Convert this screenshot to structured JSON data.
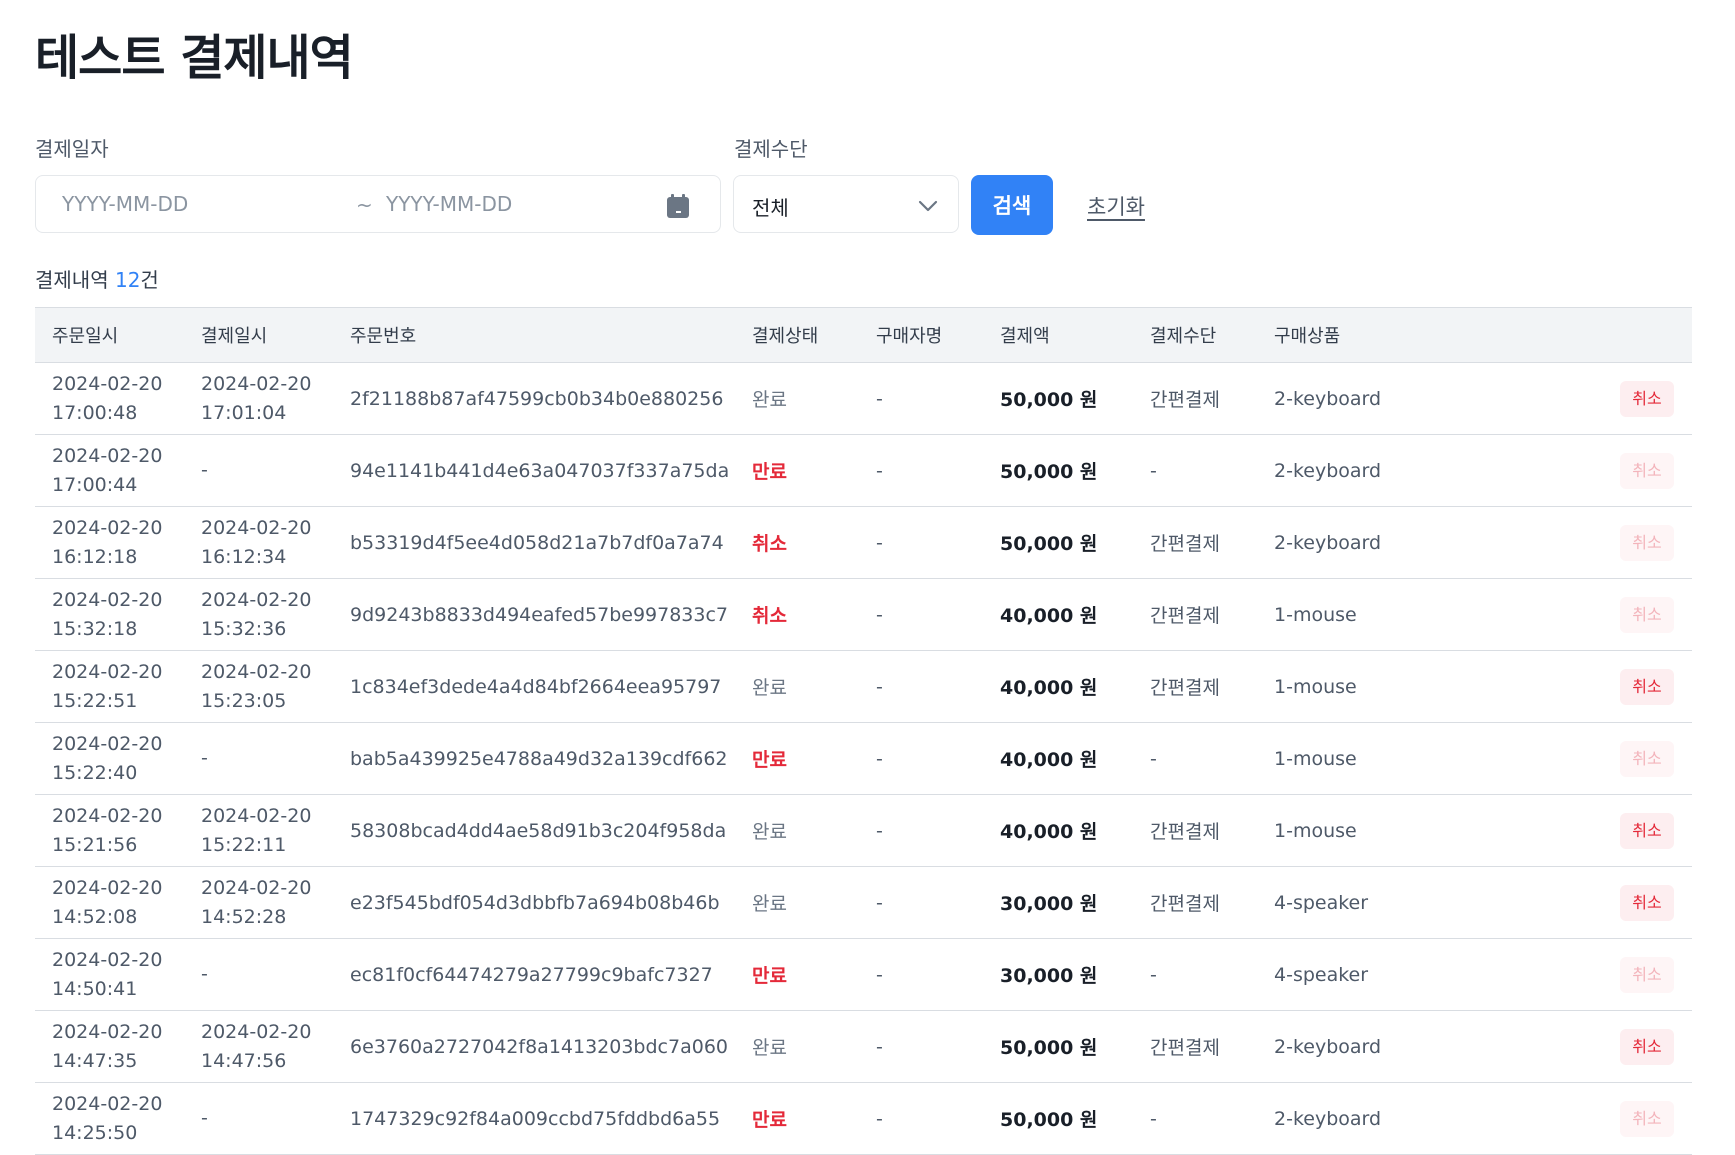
{
  "page": {
    "title": "테스트 결제내역"
  },
  "filters": {
    "date_label": "결제일자",
    "start_placeholder": "YYYY-MM-DD",
    "separator": "~",
    "end_placeholder": "YYYY-MM-DD",
    "method_label": "결제수단",
    "method_value": "전체",
    "search_label": "검색",
    "reset_label": "초기화"
  },
  "summary": {
    "prefix": "결제내역",
    "count": "12",
    "suffix": "건"
  },
  "colors": {
    "accent": "#3182f6",
    "danger": "#e42939",
    "header_bg": "#f2f4f6"
  },
  "table": {
    "headers": [
      "주문일시",
      "결제일시",
      "주문번호",
      "결제상태",
      "구매자명",
      "결제액",
      "결제수단",
      "구매상품"
    ],
    "cancel_label": "취소",
    "rows": [
      {
        "order_date": "2024-02-20",
        "order_time": "17:00:48",
        "pay_date": "2024-02-20",
        "pay_time": "17:01:04",
        "order_no": "2f21188b87af47599cb0b34b0e880256",
        "status": "완료",
        "buyer": "-",
        "amount": "50,000 원",
        "method": "간편결제",
        "product": "2-keyboard",
        "cancel_enabled": true
      },
      {
        "order_date": "2024-02-20",
        "order_time": "17:00:44",
        "pay_date": "-",
        "pay_time": "",
        "order_no": "94e1141b441d4e63a047037f337a75da",
        "status": "만료",
        "buyer": "-",
        "amount": "50,000 원",
        "method": "-",
        "product": "2-keyboard",
        "cancel_enabled": false
      },
      {
        "order_date": "2024-02-20",
        "order_time": "16:12:18",
        "pay_date": "2024-02-20",
        "pay_time": "16:12:34",
        "order_no": "b53319d4f5ee4d058d21a7b7df0a7a74",
        "status": "취소",
        "buyer": "-",
        "amount": "50,000 원",
        "method": "간편결제",
        "product": "2-keyboard",
        "cancel_enabled": false
      },
      {
        "order_date": "2024-02-20",
        "order_time": "15:32:18",
        "pay_date": "2024-02-20",
        "pay_time": "15:32:36",
        "order_no": "9d9243b8833d494eafed57be997833c7",
        "status": "취소",
        "buyer": "-",
        "amount": "40,000 원",
        "method": "간편결제",
        "product": "1-mouse",
        "cancel_enabled": false
      },
      {
        "order_date": "2024-02-20",
        "order_time": "15:22:51",
        "pay_date": "2024-02-20",
        "pay_time": "15:23:05",
        "order_no": "1c834ef3dede4a4d84bf2664eea95797",
        "status": "완료",
        "buyer": "-",
        "amount": "40,000 원",
        "method": "간편결제",
        "product": "1-mouse",
        "cancel_enabled": true
      },
      {
        "order_date": "2024-02-20",
        "order_time": "15:22:40",
        "pay_date": "-",
        "pay_time": "",
        "order_no": "bab5a439925e4788a49d32a139cdf662",
        "status": "만료",
        "buyer": "-",
        "amount": "40,000 원",
        "method": "-",
        "product": "1-mouse",
        "cancel_enabled": false
      },
      {
        "order_date": "2024-02-20",
        "order_time": "15:21:56",
        "pay_date": "2024-02-20",
        "pay_time": "15:22:11",
        "order_no": "58308bcad4dd4ae58d91b3c204f958da",
        "status": "완료",
        "buyer": "-",
        "amount": "40,000 원",
        "method": "간편결제",
        "product": "1-mouse",
        "cancel_enabled": true
      },
      {
        "order_date": "2024-02-20",
        "order_time": "14:52:08",
        "pay_date": "2024-02-20",
        "pay_time": "14:52:28",
        "order_no": "e23f545bdf054d3dbbfb7a694b08b46b",
        "status": "완료",
        "buyer": "-",
        "amount": "30,000 원",
        "method": "간편결제",
        "product": "4-speaker",
        "cancel_enabled": true
      },
      {
        "order_date": "2024-02-20",
        "order_time": "14:50:41",
        "pay_date": "-",
        "pay_time": "",
        "order_no": "ec81f0cf64474279a27799c9bafc7327",
        "status": "만료",
        "buyer": "-",
        "amount": "30,000 원",
        "method": "-",
        "product": "4-speaker",
        "cancel_enabled": false
      },
      {
        "order_date": "2024-02-20",
        "order_time": "14:47:35",
        "pay_date": "2024-02-20",
        "pay_time": "14:47:56",
        "order_no": "6e3760a2727042f8a1413203bdc7a060",
        "status": "완료",
        "buyer": "-",
        "amount": "50,000 원",
        "method": "간편결제",
        "product": "2-keyboard",
        "cancel_enabled": true
      },
      {
        "order_date": "2024-02-20",
        "order_time": "14:25:50",
        "pay_date": "-",
        "pay_time": "",
        "order_no": "1747329c92f84a009ccbd75fddbd6a55",
        "status": "만료",
        "buyer": "-",
        "amount": "50,000 원",
        "method": "-",
        "product": "2-keyboard",
        "cancel_enabled": false
      }
    ]
  }
}
